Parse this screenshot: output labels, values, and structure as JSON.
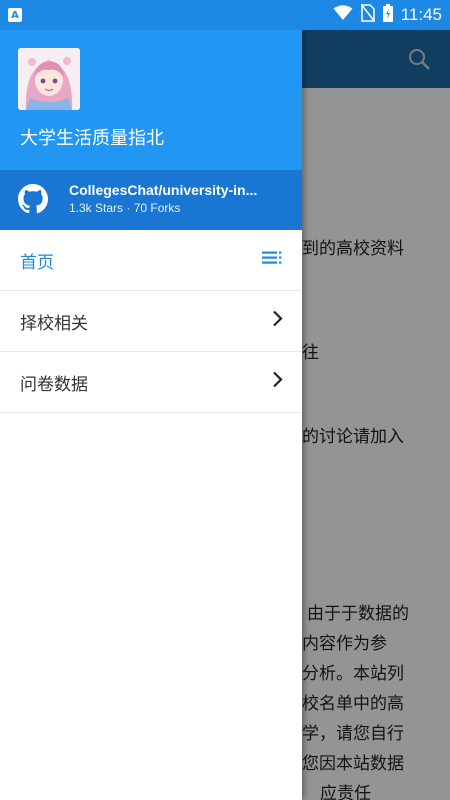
{
  "status_bar": {
    "time": "11:45",
    "notification_icon": "A",
    "icons": [
      "wifi-icon",
      "no-sim-icon",
      "battery-icon"
    ]
  },
  "background_content": {
    "lines": [
      "到的高校资料",
      "往",
      "的讨论请加入",
      "，由于于数据的",
      "内容作为参",
      "分析。本站列",
      "校名单中的高",
      "学，请您自行",
      "您因本站数据",
      "应责任"
    ]
  },
  "drawer": {
    "title": "大学生活质量指北",
    "repo": {
      "name": "CollegesChat/university-in...",
      "stats": "1.3k Stars · 70 Forks"
    },
    "nav_items": [
      {
        "label": "首页",
        "icon": "list-icon",
        "active": true
      },
      {
        "label": "择校相关",
        "icon": "chevron-right-icon",
        "active": false
      },
      {
        "label": "问卷数据",
        "icon": "chevron-right-icon",
        "active": false
      }
    ]
  },
  "colors": {
    "primary": "#2196f3",
    "primary_dark": "#1976d2",
    "accent_text": "#1e88e5"
  }
}
